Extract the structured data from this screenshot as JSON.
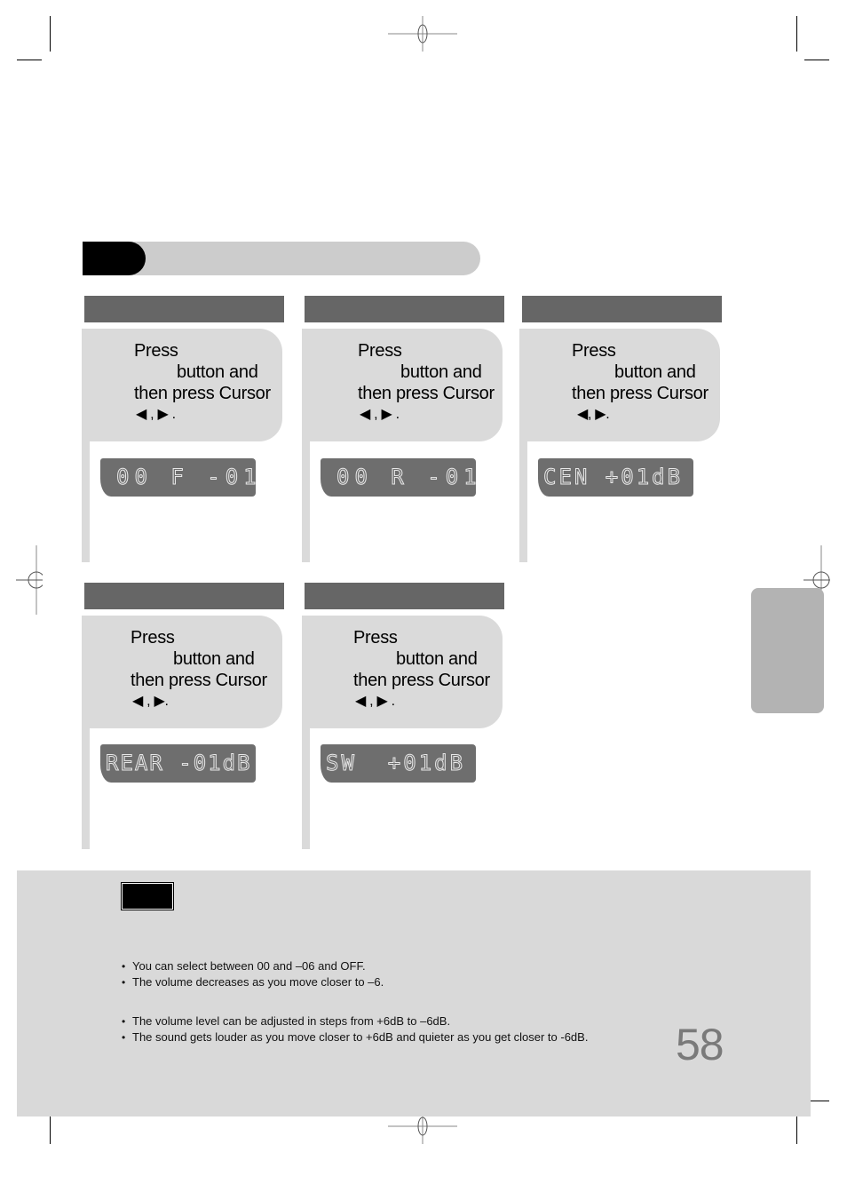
{
  "page": {
    "page_number": "58",
    "colors": {
      "card_header": "#666666",
      "bubble": "#dadada",
      "lcd": "#6e6e6e",
      "title_pill": "#000000",
      "title_bar": "#cccccc",
      "side_tab": "#b3b3b3",
      "notes_bg": "#d9d9d9",
      "page_number": "#7a7a7a"
    }
  },
  "cards": [
    {
      "header": "",
      "instruction": {
        "line1": "Press",
        "line2": "button and",
        "line3": "then press Cursor",
        "arrows": "◀ , ▶ ."
      },
      "display": "00 F -01"
    },
    {
      "header": "",
      "instruction": {
        "line1": "Press",
        "line2": "button and",
        "line3": "then press Cursor",
        "arrows": "◀ , ▶ ."
      },
      "display": "00 R -01"
    },
    {
      "header": "",
      "instruction": {
        "line1": "Press",
        "line2": "button and",
        "line3": "then press Cursor",
        "arrows": "◀, ▶."
      },
      "display": "CEN +01dB"
    },
    {
      "header": "",
      "instruction": {
        "line1": "Press",
        "line2": "button and",
        "line3": "then press Cursor",
        "arrows": "◀ , ▶."
      },
      "display": "REAR -01dB"
    },
    {
      "header": "",
      "instruction": {
        "line1": "Press",
        "line2": "button and",
        "line3": "then press Cursor",
        "arrows": "◀ , ▶ ."
      },
      "display": "SW  +01dB"
    }
  ],
  "notes": {
    "label": "",
    "group1": [
      "You can select between 00 and –06 and OFF.",
      "The volume decreases as you move closer to –6."
    ],
    "group2": [
      "The volume level can be adjusted in steps from +6dB to –6dB.",
      "The sound gets louder as you move closer to +6dB and quieter as you get closer to -6dB."
    ]
  }
}
